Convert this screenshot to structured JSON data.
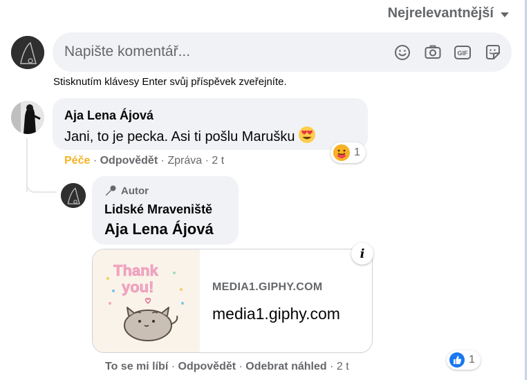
{
  "sort": {
    "label": "Nejrelevantnější",
    "icon": "caret-down-icon"
  },
  "composer": {
    "placeholder": "Napište komentář...",
    "hint": "Stisknutím klávesy Enter svůj příspěvek zveřejníte.",
    "icons": [
      "emoji-icon",
      "camera-icon",
      "gif-icon",
      "sticker-icon"
    ],
    "gif_label": "GIF"
  },
  "comment": {
    "author": "Aja Lena Ájová",
    "text": "Jani, to je pecka. Asi ti pošlu Marušku",
    "emoji": "heart-eyes-emoji",
    "reaction": {
      "icon": "care-reaction-icon",
      "count": "1"
    },
    "actions": {
      "care": "Péče",
      "reply": "Odpovědět",
      "message": "Zpráva",
      "time": "2 t",
      "sep": " · "
    }
  },
  "reply": {
    "badge": "Autor",
    "author": "Lidské Mraveniště",
    "tagged": "Aja Lena Ájová",
    "preview": {
      "image_label": "Thank you!",
      "domain_caps": "MEDIA1.GIPHY.COM",
      "domain": "media1.giphy.com",
      "info": "i"
    },
    "reaction": {
      "icon": "like-reaction-icon",
      "count": "1"
    },
    "actions": {
      "like": "To se mi líbí",
      "reply": "Odpovědět",
      "remove_preview": "Odebrat náhled",
      "time": "2 t",
      "sep": " · "
    }
  },
  "colors": {
    "bubble": "#f0f2f5",
    "secondary_text": "#65676b",
    "care": "#f7b125",
    "like": "#1877f2"
  }
}
